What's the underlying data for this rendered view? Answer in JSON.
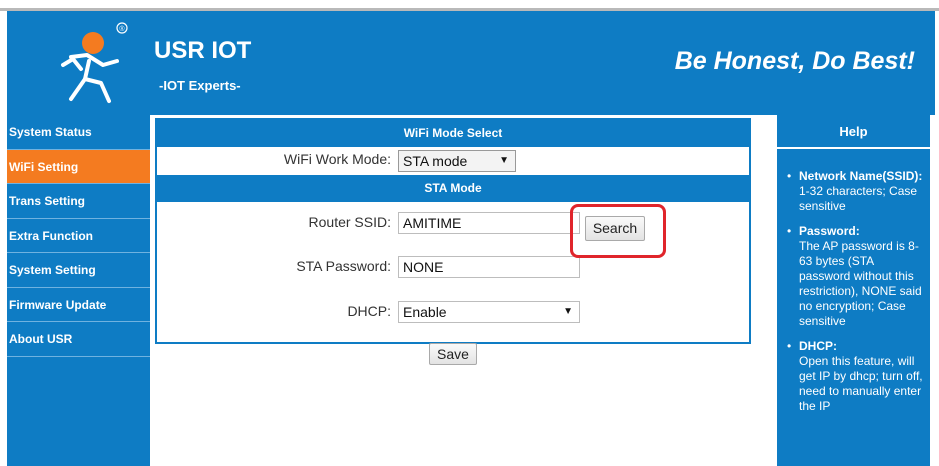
{
  "header": {
    "brand": "USR IOT",
    "tagline": "-IOT Experts-",
    "slogan": "Be Honest, Do Best!",
    "registered_mark": "®"
  },
  "sidebar": {
    "items": [
      {
        "label": "System Status",
        "active": false
      },
      {
        "label": "WiFi Setting",
        "active": true
      },
      {
        "label": "Trans Setting",
        "active": false
      },
      {
        "label": "Extra Function",
        "active": false
      },
      {
        "label": "System Setting",
        "active": false
      },
      {
        "label": "Firmware Update",
        "active": false
      },
      {
        "label": "About USR",
        "active": false
      }
    ]
  },
  "main": {
    "wifi_mode_section": "WiFi Mode Select",
    "work_mode_label": "WiFi Work Mode:",
    "work_mode_value": "STA mode",
    "sta_section": "STA Mode",
    "ssid_label": "Router SSID:",
    "ssid_value": "AMITIME",
    "search_label": "Search",
    "password_label": "STA Password:",
    "password_value": "NONE",
    "dhcp_label": "DHCP:",
    "dhcp_value": "Enable",
    "save_label": "Save"
  },
  "help": {
    "title": "Help",
    "items": [
      {
        "title": "Network Name(SSID):",
        "text": "1-32 characters; Case sensitive"
      },
      {
        "title": "Password:",
        "text": "The AP password is 8-63 bytes (STA password without this restriction), NONE said no encryption; Case sensitive"
      },
      {
        "title": "DHCP:",
        "text": "Open this feature, will get IP by dhcp; turn off, need to manually enter the IP"
      }
    ]
  },
  "colors": {
    "primary": "#0e7cc4",
    "active_nav": "#f47b20",
    "highlight": "#e0252b"
  }
}
